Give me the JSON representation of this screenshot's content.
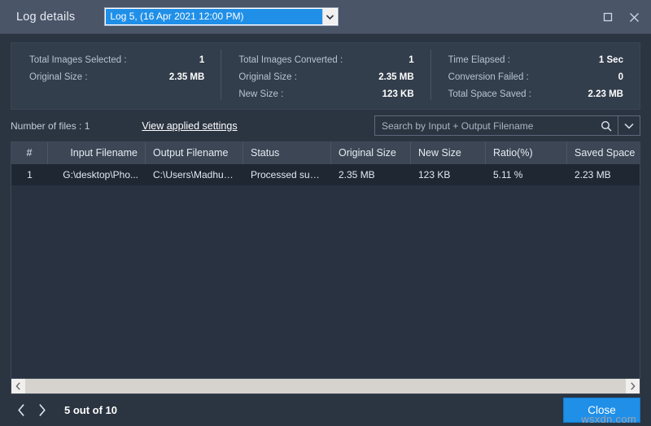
{
  "window": {
    "title": "Log details",
    "log_selector": {
      "value": "Log 5, (16 Apr 2021 12:00 PM)",
      "arrow_icon": "chevron-down-icon"
    },
    "controls": {
      "maximize_icon": "maximize-icon",
      "close_icon": "close-icon"
    }
  },
  "stats": {
    "columns": [
      {
        "rows": [
          {
            "label": "Total Images Selected :",
            "value": "1"
          },
          {
            "label": "Original Size :",
            "value": "2.35 MB"
          }
        ]
      },
      {
        "rows": [
          {
            "label": "Total Images Converted :",
            "value": "1"
          },
          {
            "label": "Original Size :",
            "value": "2.35 MB"
          },
          {
            "label": "New Size :",
            "value": "123 KB"
          }
        ]
      },
      {
        "rows": [
          {
            "label": "Time Elapsed :",
            "value": "1 Sec"
          },
          {
            "label": "Conversion Failed :",
            "value": "0"
          },
          {
            "label": "Total Space Saved :",
            "value": "2.23 MB"
          }
        ]
      }
    ]
  },
  "toolbar": {
    "files_count": "Number of files : 1",
    "view_settings_link": "View applied settings",
    "search": {
      "value": "",
      "placeholder": "Search by Input + Output Filename",
      "search_icon": "search-icon",
      "dropdown_icon": "chevron-down-icon"
    }
  },
  "table": {
    "headers": [
      "#",
      "Input Filename",
      "Output Filename",
      "Status",
      "Original Size",
      "New Size",
      "Ratio(%)",
      "Saved Space"
    ],
    "rows": [
      {
        "num": "1",
        "input_filename": "G:\\desktop\\Pho...",
        "output_filename": "C:\\Users\\Madhuri...",
        "status": "Processed succes...",
        "original_size": "2.35 MB",
        "new_size": "123 KB",
        "ratio": "5.11 %",
        "saved_space": "2.23 MB"
      }
    ]
  },
  "scrollbar": {
    "left_arrow_icon": "chevron-left-icon",
    "right_arrow_icon": "chevron-right-icon"
  },
  "footer": {
    "prev_icon": "chevron-left-icon",
    "next_icon": "chevron-right-icon",
    "page_status": "5 out of 10",
    "close_label": "Close"
  },
  "watermark": "wsxdn.com",
  "colors": {
    "window_bg": "#2b3441",
    "titlebar_bg": "#4a5568",
    "panel_bg": "#333e4c",
    "accent_blue": "#1f8fe8",
    "table_header_bg": "#3c4655",
    "table_row_bg": "#1f2733",
    "text_primary": "#ffffff",
    "text_muted": "#b9c3d0"
  }
}
